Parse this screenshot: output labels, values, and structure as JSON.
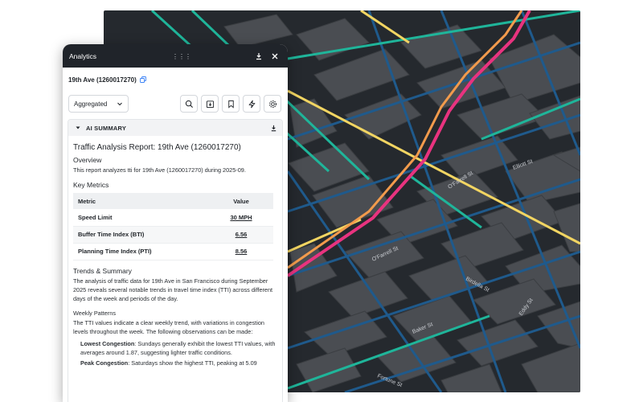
{
  "panel": {
    "title": "Analytics",
    "drag_glyph": "⋮⋮⋮",
    "segment_name": "19th Ave (1260017270)",
    "dropdown_value": "Aggregated",
    "icons": [
      "download-icon",
      "close-icon",
      "copy-icon",
      "search-icon",
      "export-icon",
      "bookmark-icon",
      "lightning-icon",
      "settings-icon"
    ]
  },
  "summary": {
    "section_title": "AI SUMMARY",
    "report_title": "Traffic Analysis Report: 19th Ave (1260017270)",
    "overview_heading": "Overview",
    "overview_text": "This report analyzes tti for 19th Ave (1260017270) during 2025-09.",
    "metrics_heading": "Key Metrics",
    "metrics_columns": [
      "Metric",
      "Value"
    ],
    "metrics_rows": [
      {
        "metric": "Speed Limit",
        "value": "30 MPH"
      },
      {
        "metric": "Buffer Time Index (BTI)",
        "value": "6.56"
      },
      {
        "metric": "Planning Time Index (PTI)",
        "value": "8.56"
      }
    ],
    "trends_heading": "Trends & Summary",
    "trends_text": "The analysis of traffic data for 19th Ave in San Francisco during September 2025 reveals several notable trends in travel time index (TTI) across different days of the week and periods of the day.",
    "weekly_heading": "Weekly Patterns",
    "weekly_text": "The TTI values indicate a clear weekly trend, with variations in congestion levels throughout the week. The following observations can be made:",
    "bullet1_bold": "Lowest Congestion",
    "bullet1_text": ": Sundays generally exhibit the lowest TTI values, with averages around 1.87, suggesting lighter traffic conditions.",
    "bullet2_bold": "Peak Congestion",
    "bullet2_text": ": Saturdays show the highest TTI, peaking at 5.09"
  },
  "map": {
    "street_labels": [
      "O'Farrell St",
      "O'Farrell St",
      "Elliott St",
      "Baker St",
      "Birdella St",
      "Eddy St",
      "Fortune St"
    ],
    "colors": {
      "bg": "#25292e",
      "blue": "#1f5a8c",
      "teal": "#1fb59a",
      "yellow": "#f2d562",
      "pink": "#e8337f",
      "orange": "#f29b4c"
    }
  }
}
